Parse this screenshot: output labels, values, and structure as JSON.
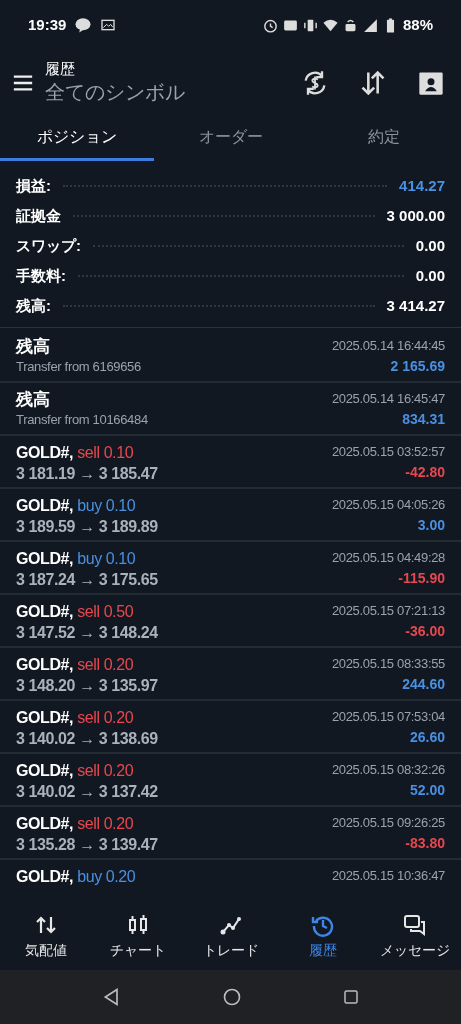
{
  "status_bar": {
    "time": "19:39",
    "battery": "88%"
  },
  "header": {
    "title": "履歴",
    "subtitle": "全てのシンボル"
  },
  "tabs": [
    {
      "label": "ポジション",
      "selected": true
    },
    {
      "label": "オーダー",
      "selected": false
    },
    {
      "label": "約定",
      "selected": false
    }
  ],
  "summary": [
    {
      "label": "損益:",
      "value": "414.27",
      "highlight": true
    },
    {
      "label": "証拠金",
      "value": "3 000.00",
      "highlight": false
    },
    {
      "label": "スワップ:",
      "value": "0.00",
      "highlight": false
    },
    {
      "label": "手数料:",
      "value": "0.00",
      "highlight": false
    },
    {
      "label": "残高:",
      "value": "3 414.27",
      "highlight": false
    }
  ],
  "rows": [
    {
      "kind": "balance",
      "title": "残高",
      "detail": "Transfer from 6169656",
      "time": "2025.05.14 16:44:45",
      "amount": "2 165.69",
      "gain": true
    },
    {
      "kind": "balance",
      "title": "残高",
      "detail": "Transfer from 10166484",
      "time": "2025.05.14 16:45:47",
      "amount": "834.31",
      "gain": true
    },
    {
      "kind": "trade",
      "symbol": "GOLD#,",
      "sell": true,
      "order": "sell 0.10",
      "prices": "3 181.19 → 3 185.47",
      "time": "2025.05.15 03:52:57",
      "amount": "-42.80",
      "gain": false
    },
    {
      "kind": "trade",
      "symbol": "GOLD#,",
      "sell": false,
      "order": "buy 0.10",
      "prices": "3 189.59 → 3 189.89",
      "time": "2025.05.15 04:05:26",
      "amount": "3.00",
      "gain": true
    },
    {
      "kind": "trade",
      "symbol": "GOLD#,",
      "sell": false,
      "order": "buy 0.10",
      "prices": "3 187.24 → 3 175.65",
      "time": "2025.05.15 04:49:28",
      "amount": "-115.90",
      "gain": false
    },
    {
      "kind": "trade",
      "symbol": "GOLD#,",
      "sell": true,
      "order": "sell 0.50",
      "prices": "3 147.52 → 3 148.24",
      "time": "2025.05.15 07:21:13",
      "amount": "-36.00",
      "gain": false
    },
    {
      "kind": "trade",
      "symbol": "GOLD#,",
      "sell": true,
      "order": "sell 0.20",
      "prices": "3 148.20 → 3 135.97",
      "time": "2025.05.15 08:33:55",
      "amount": "244.60",
      "gain": true
    },
    {
      "kind": "trade",
      "symbol": "GOLD#,",
      "sell": true,
      "order": "sell 0.20",
      "prices": "3 140.02 → 3 138.69",
      "time": "2025.05.15 07:53:04",
      "amount": "26.60",
      "gain": true
    },
    {
      "kind": "trade",
      "symbol": "GOLD#,",
      "sell": true,
      "order": "sell 0.20",
      "prices": "3 140.02 → 3 137.42",
      "time": "2025.05.15 08:32:26",
      "amount": "52.00",
      "gain": true
    },
    {
      "kind": "trade",
      "symbol": "GOLD#,",
      "sell": true,
      "order": "sell 0.20",
      "prices": "3 135.28 → 3 139.47",
      "time": "2025.05.15 09:26:25",
      "amount": "-83.80",
      "gain": false
    },
    {
      "kind": "trade",
      "symbol": "GOLD#,",
      "sell": false,
      "order": "buy 0.20",
      "time": "2025.05.15 10:36:47"
    }
  ],
  "bottom_nav": [
    {
      "label": "気配値",
      "selected": false
    },
    {
      "label": "チャート",
      "selected": false
    },
    {
      "label": "トレード",
      "selected": false
    },
    {
      "label": "履歴",
      "selected": true
    },
    {
      "label": "メッセージ",
      "selected": false
    }
  ]
}
